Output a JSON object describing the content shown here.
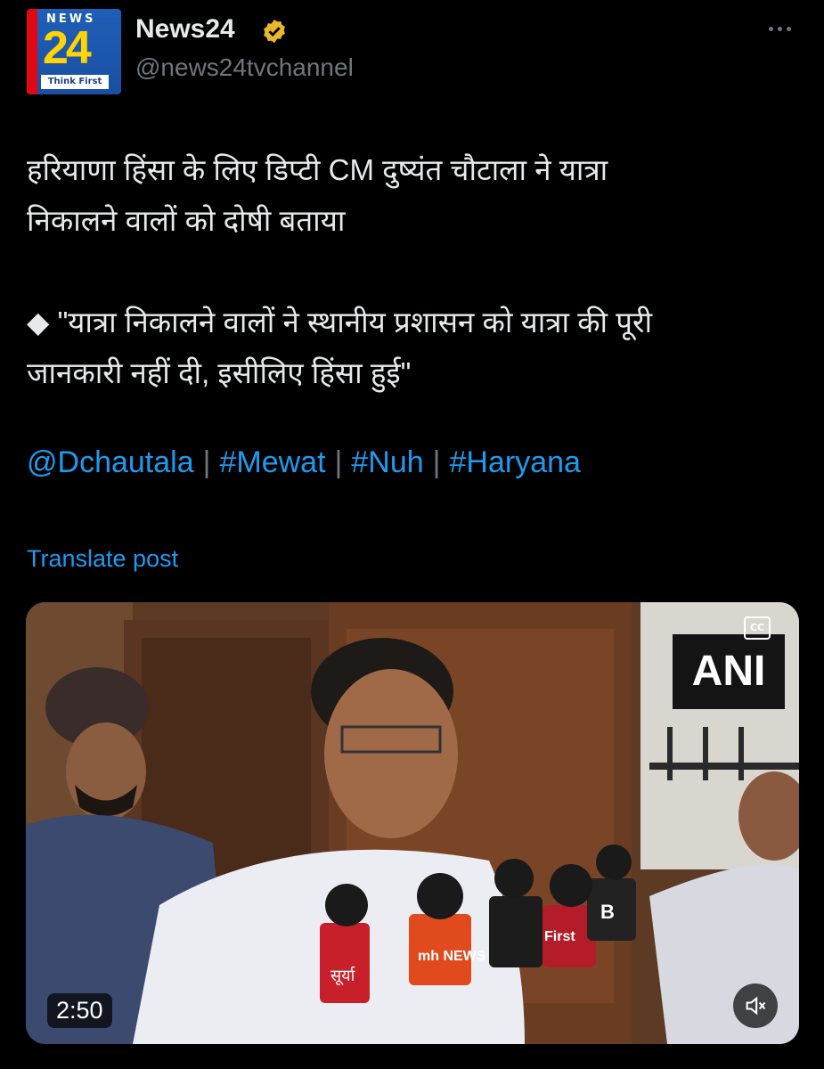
{
  "author": {
    "avatar": {
      "top_text": "NEWS",
      "number": "24",
      "tagline": "Think First"
    },
    "display_name": "News24",
    "handle": "@news24tvchannel",
    "verified_icon": "verified-badge-icon",
    "more_icon": "more-options-icon"
  },
  "post": {
    "line1": "हरियाणा हिंसा के लिए डिप्टी CM दुष्यंत चौटाला ने यात्रा",
    "line2": "निकालने वालों को दोषी बताया",
    "quote_bullet": "◆",
    "quote_line1": "\"यात्रा निकालने वालों ने स्थानीय प्रशासन को यात्रा की पूरी",
    "quote_line2": "जानकारी नहीं दी, इसीलिए हिंसा हुई\"",
    "links": [
      "@Dchautala",
      "#Mewat",
      "#Nuh",
      "#Haryana"
    ],
    "separator": "|",
    "translate_label": "Translate post"
  },
  "video": {
    "watermark": "ANI",
    "cc_label": "CC",
    "duration": "2:50",
    "mic_labels": [
      "सूर्या",
      "mh NEWS",
      "First",
      "B"
    ],
    "mute_icon": "speaker-muted-icon"
  },
  "colors": {
    "link": "#1d9bf0",
    "muted": "#71767b",
    "text": "#e7e9ea",
    "background": "#000000"
  }
}
